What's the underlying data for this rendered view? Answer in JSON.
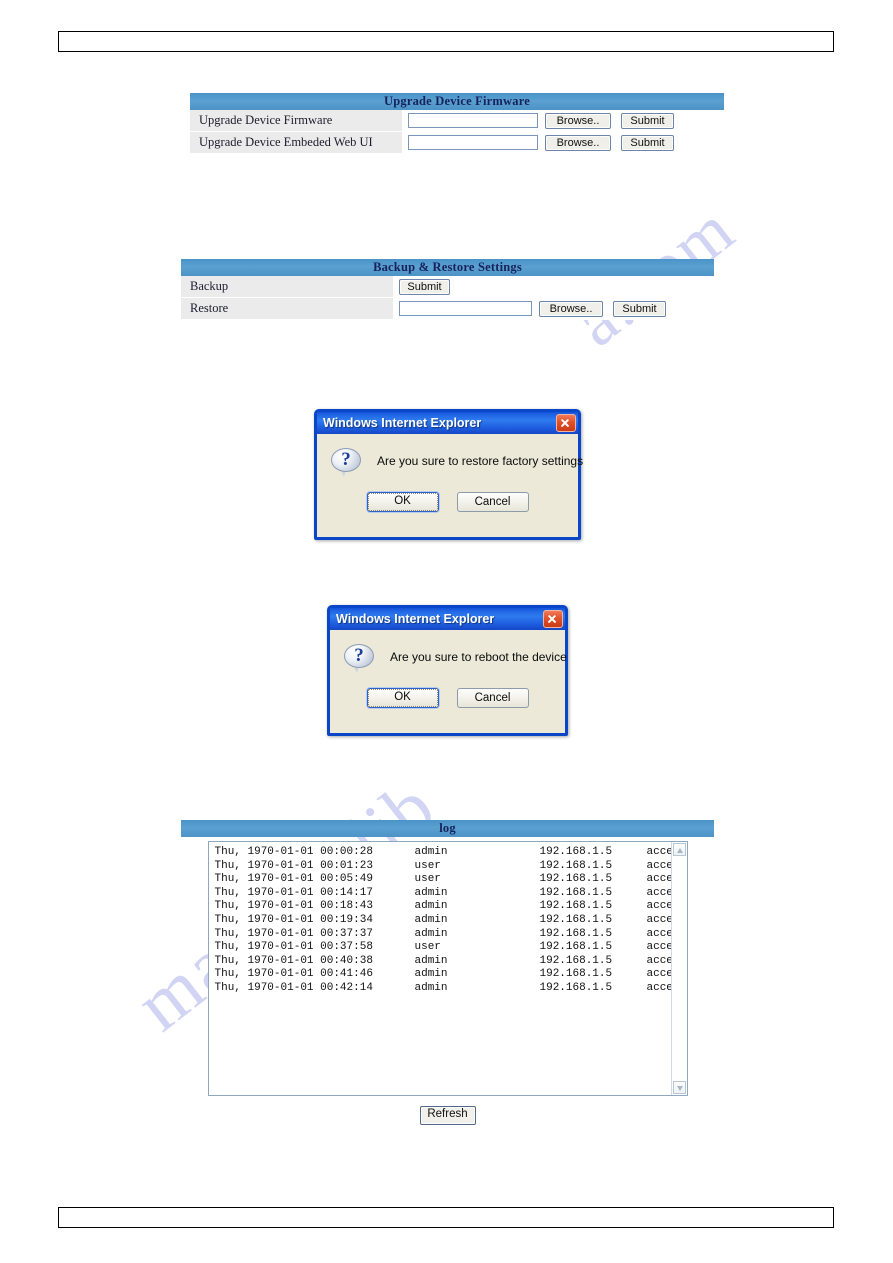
{
  "watermark": {
    "line1": "manualslib",
    "line2": "a.com"
  },
  "header_bar": {
    "text": ""
  },
  "footer_bar": {
    "text": ""
  },
  "upgrade_panel": {
    "title": "Upgrade Device Firmware",
    "rows": [
      {
        "label": "Upgrade Device Firmware",
        "input_value": "",
        "browse_label": "Browse..",
        "submit_label": "Submit"
      },
      {
        "label": "Upgrade Device Embeded Web UI",
        "input_value": "",
        "browse_label": "Browse..",
        "submit_label": "Submit"
      }
    ]
  },
  "backup_panel": {
    "title": "Backup & Restore Settings",
    "backup": {
      "label": "Backup",
      "submit_label": "Submit"
    },
    "restore": {
      "label": "Restore",
      "input_value": "",
      "browse_label": "Browse..",
      "submit_label": "Submit"
    }
  },
  "dialog_restore": {
    "title": "Windows Internet Explorer",
    "message": "Are you sure to restore factory settings",
    "ok_label": "OK",
    "cancel_label": "Cancel",
    "icon": "question-icon",
    "close_icon": "close-icon"
  },
  "dialog_reboot": {
    "title": "Windows Internet Explorer",
    "message": "Are you sure to reboot the device",
    "ok_label": "OK",
    "cancel_label": "Cancel",
    "icon": "question-icon",
    "close_icon": "close-icon"
  },
  "log_panel": {
    "title": "log",
    "refresh_label": "Refresh",
    "entries": [
      {
        "timestamp": "Thu, 1970-01-01 00:00:28",
        "user": "admin",
        "ip": "192.168.1.5",
        "action": "access"
      },
      {
        "timestamp": "Thu, 1970-01-01 00:01:23",
        "user": "user",
        "ip": "192.168.1.5",
        "action": "access"
      },
      {
        "timestamp": "Thu, 1970-01-01 00:05:49",
        "user": "user",
        "ip": "192.168.1.5",
        "action": "access"
      },
      {
        "timestamp": "Thu, 1970-01-01 00:14:17",
        "user": "admin",
        "ip": "192.168.1.5",
        "action": "access"
      },
      {
        "timestamp": "Thu, 1970-01-01 00:18:43",
        "user": "admin",
        "ip": "192.168.1.5",
        "action": "access"
      },
      {
        "timestamp": "Thu, 1970-01-01 00:19:34",
        "user": "admin",
        "ip": "192.168.1.5",
        "action": "access"
      },
      {
        "timestamp": "Thu, 1970-01-01 00:37:37",
        "user": "admin",
        "ip": "192.168.1.5",
        "action": "access"
      },
      {
        "timestamp": "Thu, 1970-01-01 00:37:58",
        "user": "user",
        "ip": "192.168.1.5",
        "action": "access"
      },
      {
        "timestamp": "Thu, 1970-01-01 00:40:38",
        "user": "admin",
        "ip": "192.168.1.5",
        "action": "access"
      },
      {
        "timestamp": "Thu, 1970-01-01 00:41:46",
        "user": "admin",
        "ip": "192.168.1.5",
        "action": "access"
      },
      {
        "timestamp": "Thu, 1970-01-01 00:42:14",
        "user": "admin",
        "ip": "192.168.1.5",
        "action": "access"
      }
    ]
  },
  "colors": {
    "panel_header_blue": "#4d93c6",
    "panel_header_text": "#16225c",
    "row_label_bg": "#ebebeb",
    "dialog_titlebar_blue": "#1f64e4",
    "dialog_close_red": "#d4431c",
    "dialog_body": "#ece9d8",
    "watermark": "#c9cdf0"
  }
}
